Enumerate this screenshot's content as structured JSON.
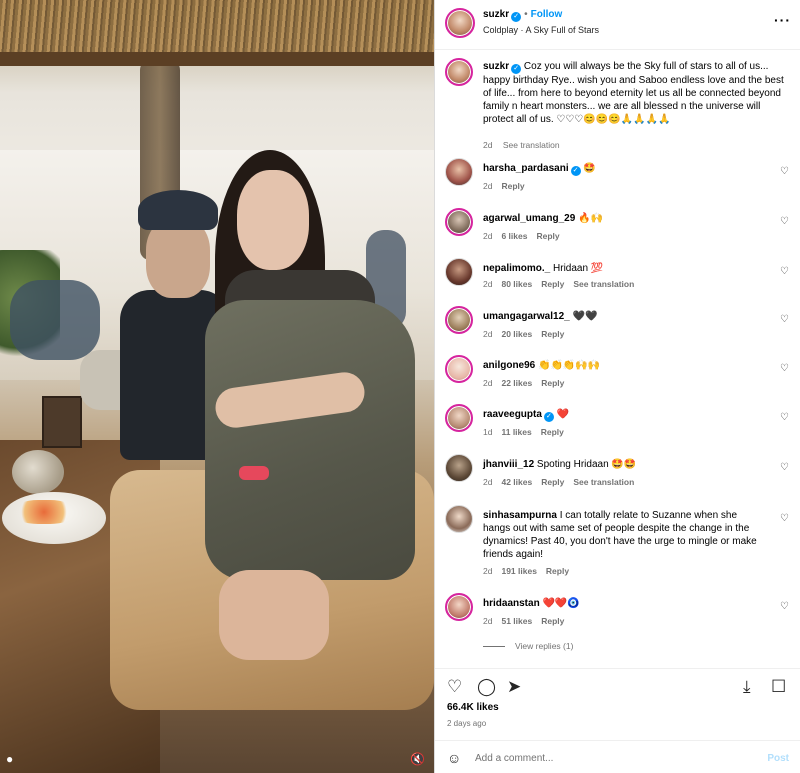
{
  "post": {
    "username": "suzkr",
    "follow_label": "Follow",
    "music": "Coldplay · A Sky Full of Stars",
    "more_icon": "more-horizontal-icon"
  },
  "caption": {
    "username": "suzkr",
    "text": "Coz you will always be the Sky full of stars to all of us... happy birthday Rye.. wish you and Saboo endless love and the best of life... from here to beyond eternity let us all be connected beyond family n heart monsters... we are all blessed n the universe will protect all of us. ♡♡♡😊😊😊🙏🙏🙏🙏",
    "time": "2d",
    "see_translation": "See translation"
  },
  "comments": [
    {
      "user": "harsha_pardasani",
      "verified": true,
      "text": "🤩",
      "time": "2d",
      "likes": "",
      "reply": "Reply",
      "translation": ""
    },
    {
      "user": "agarwal_umang_29",
      "verified": false,
      "text": "🔥🙌",
      "time": "2d",
      "likes": "6 likes",
      "reply": "Reply",
      "translation": ""
    },
    {
      "user": "nepalimomo._",
      "verified": false,
      "text": "Hridaan 💯",
      "time": "2d",
      "likes": "80 likes",
      "reply": "Reply",
      "translation": "See translation"
    },
    {
      "user": "umangagarwal12_",
      "verified": false,
      "text": "🖤🖤",
      "time": "2d",
      "likes": "20 likes",
      "reply": "Reply",
      "translation": ""
    },
    {
      "user": "anilgone96",
      "verified": false,
      "text": "👏👏👏🙌🙌",
      "time": "2d",
      "likes": "22 likes",
      "reply": "Reply",
      "translation": ""
    },
    {
      "user": "raaveegupta",
      "verified": true,
      "text": "❤️",
      "time": "1d",
      "likes": "11 likes",
      "reply": "Reply",
      "translation": ""
    },
    {
      "user": "jhanviii_12",
      "verified": false,
      "text": "Spoting Hridaan 🤩🤩",
      "time": "2d",
      "likes": "42 likes",
      "reply": "Reply",
      "translation": "See translation"
    },
    {
      "user": "sinhasampurna",
      "verified": false,
      "text": "I can totally relate to Suzanne when she hangs out with same set of people despite the change in the dynamics! Past 40, you don't have the urge to mingle or make friends again!",
      "time": "2d",
      "likes": "191 likes",
      "reply": "Reply",
      "translation": ""
    },
    {
      "user": "hridaanstan",
      "verified": false,
      "text": "❤️❤️🧿",
      "time": "2d",
      "likes": "51 likes",
      "reply": "Reply",
      "translation": ""
    }
  ],
  "view_replies": "View replies (1)",
  "stats": {
    "likes": "66.4K likes",
    "ago": "2 days ago"
  },
  "composer": {
    "placeholder": "Add a comment...",
    "post_label": "Post"
  },
  "colors": {
    "accent": "#0095f6",
    "verified": "#0095f6",
    "muted": "#737373"
  }
}
